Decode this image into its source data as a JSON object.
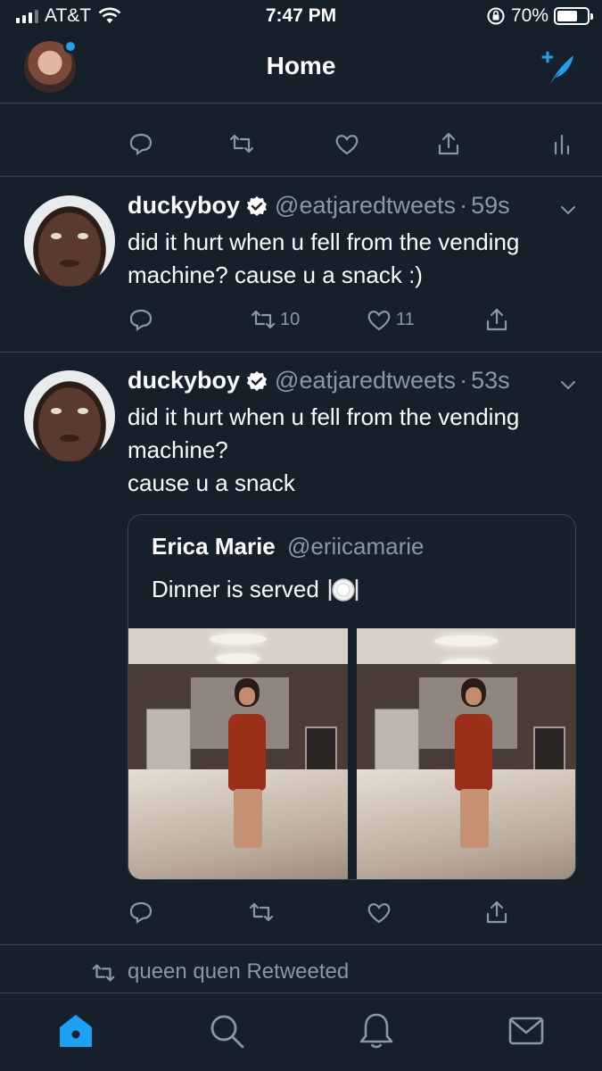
{
  "status_bar": {
    "carrier": "AT&T",
    "time": "7:47 PM",
    "battery_percent": "70%",
    "battery_level": 0.7
  },
  "header": {
    "title": "Home",
    "avatar_icon": "profile-avatar",
    "compose_icon": "compose-tweet-icon",
    "accent_color": "#1da1f2"
  },
  "tweets": [
    {
      "name": "duckyboy",
      "handle": "@eatjaredtweets",
      "separator": "·",
      "ago": "59s",
      "text": "did it hurt when u fell from the vending machine? cause u a snack :)",
      "reply_count": "",
      "retweet_count": "10",
      "like_count": "11"
    },
    {
      "name": "duckyboy",
      "handle": "@eatjaredtweets",
      "separator": "·",
      "ago": "53s",
      "text_lines": [
        "did it hurt when u fell from the vending",
        "machine?",
        "cause u a snack"
      ],
      "quote": {
        "name": "Erica Marie",
        "handle": "@eriicamarie",
        "text": "Dinner is served",
        "emoji_icon": "plate-cutlery-icon",
        "photo_count": 2
      }
    }
  ],
  "retweet_context": {
    "text": "queen quen Retweeted"
  },
  "tabbar": {
    "items": [
      "home-icon",
      "search-icon",
      "notifications-icon",
      "messages-icon"
    ],
    "active": "home-icon"
  },
  "colors": {
    "background": "#15202b",
    "border": "#38444d",
    "secondary_text": "#8899a6",
    "accent": "#1da1f2"
  }
}
